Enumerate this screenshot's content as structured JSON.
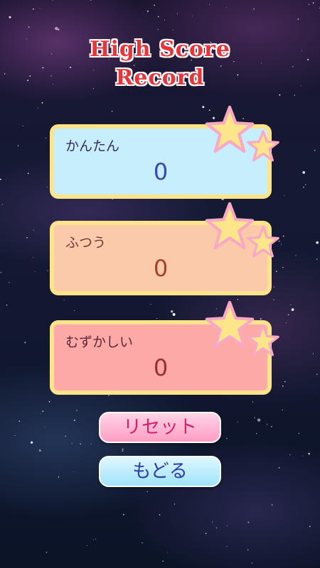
{
  "title": {
    "line1": "High Score",
    "line2": "Record"
  },
  "records": [
    {
      "label": "かんたん",
      "score": "0"
    },
    {
      "label": "ふつう",
      "score": "0"
    },
    {
      "label": "むずかしい",
      "score": "0"
    }
  ],
  "buttons": {
    "reset_label": "リセット",
    "back_label": "もどる"
  },
  "colors": {
    "title_red": "#e8353a",
    "card_border": "#fde38a",
    "easy_bg": "#c6eefc",
    "normal_bg": "#fbcaab",
    "hard_bg": "#fda9a8",
    "star_fill": "#fde68a",
    "star_outline": "#f9a8c5"
  }
}
